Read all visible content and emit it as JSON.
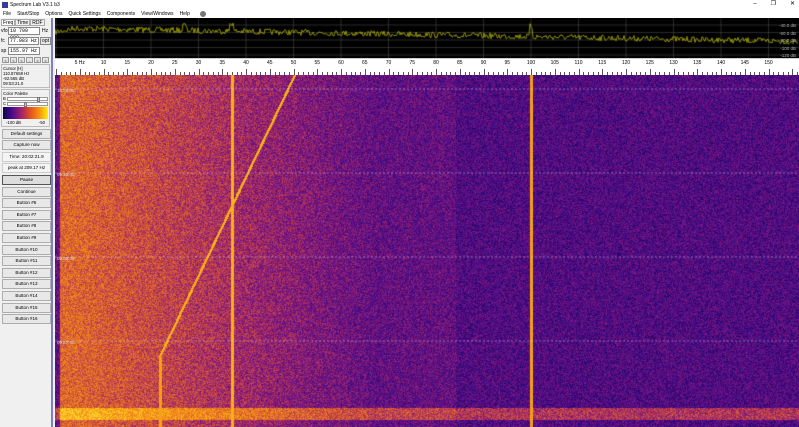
{
  "window": {
    "title": "Spectrum Lab V3.1 b3",
    "minimize": "–",
    "restore": "❐",
    "close": "✕"
  },
  "menu": [
    "File",
    "Start/Stop",
    "Options",
    "Quick Settings",
    "Components",
    "View/Windows",
    "Help"
  ],
  "left": {
    "tabs": [
      "Freq",
      "Time",
      "RDF"
    ],
    "vfo": {
      "label": "vfo",
      "value": "10 700 000",
      "unit": "Hz"
    },
    "fc": {
      "label": "fc",
      "value": "77.983 Hz",
      "button": "opt"
    },
    "sp": {
      "label": "sp",
      "value": "155.97 Hz"
    },
    "nav": [
      "<",
      "<",
      "<",
      "-",
      ">",
      ">"
    ],
    "cursor": {
      "title": "Cursor [H]",
      "freq": "110.87658 Hz",
      "level": "-92.565 dB",
      "time": "09:53:21.0"
    },
    "palette": {
      "title": "Color Palette",
      "b": "B",
      "c": "C",
      "min": "-100 dB",
      "max": "-50",
      "brightness": 0.75,
      "contrast": 0.4
    },
    "buttons": {
      "default": "Default settings",
      "capture": "Capture now",
      "time": "Time:  20:02:21.9",
      "peak": "peak at 209.17 Hz",
      "pause": "Pause",
      "continue": "Continue",
      "numbered": [
        "Button #6",
        "Button #7",
        "Button #8",
        "Button #9",
        "Button #10",
        "Button #11",
        "Button #12",
        "Button #13",
        "Button #14",
        "Button #15",
        "Button #16"
      ]
    }
  },
  "spectrum": {
    "db_labels": [
      "-40.0 dB",
      "-60.0 dB",
      "-80.0 dB",
      "-100 dB",
      "-120 dB"
    ],
    "trace_color": "#c8c800"
  },
  "freq_axis": {
    "unit": "Hz",
    "labels": [
      "5 Hz",
      "10",
      "15",
      "20",
      "25",
      "30",
      "35",
      "40",
      "45",
      "50",
      "55",
      "60",
      "65",
      "70",
      "75",
      "80",
      "85",
      "90",
      "95",
      "100",
      "105",
      "110",
      "115",
      "120",
      "125",
      "130",
      "135",
      "140",
      "145",
      "150"
    ]
  },
  "waterfall": {
    "time_labels": [
      "10:00:00",
      "09:59:00",
      "09:58:00",
      "09:57:00"
    ],
    "lines_hz": [
      37,
      100
    ]
  }
}
